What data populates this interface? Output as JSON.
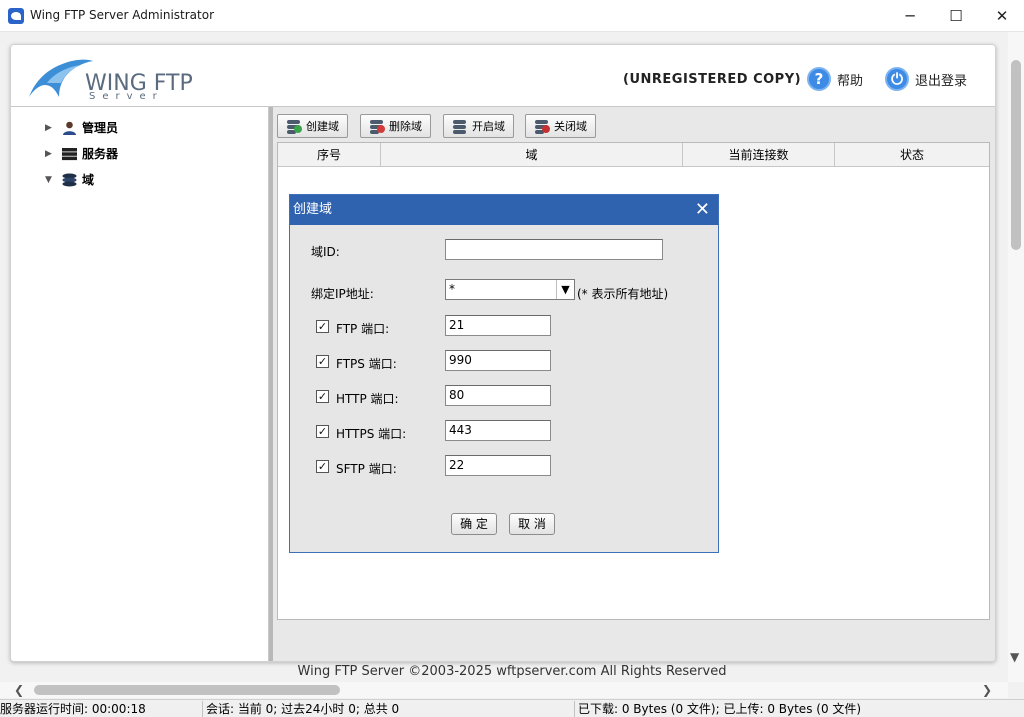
{
  "window": {
    "title": "Wing FTP Server Administrator",
    "minimize": "─",
    "maximize": "☐",
    "close": "✕"
  },
  "header": {
    "logo_text": "WING FTP",
    "logo_sub": "Server",
    "unregistered": "(UNREGISTERED COPY)",
    "help_label": "帮助",
    "help_icon": "?",
    "logout_label": "退出登录",
    "logout_icon": "⏻"
  },
  "tree": {
    "items": [
      {
        "label": "管理员",
        "icon": "user-icon"
      },
      {
        "label": "服务器",
        "icon": "server-icon"
      },
      {
        "label": "域",
        "icon": "domain-stack-icon"
      }
    ]
  },
  "toolbar": {
    "create": "创建域",
    "delete": "删除域",
    "start": "开启域",
    "stop": "关闭域"
  },
  "grid": {
    "columns": [
      "序号",
      "域",
      "当前连接数",
      "状态"
    ]
  },
  "dialog": {
    "title": "创建域",
    "domain_id_label": "域ID:",
    "domain_id_value": "",
    "bind_ip_label": "绑定IP地址:",
    "bind_ip_value": "*",
    "bind_ip_hint": "(* 表示所有地址)",
    "ports": [
      {
        "label": "FTP 端口:",
        "value": "21",
        "checked": true
      },
      {
        "label": "FTPS 端口:",
        "value": "990",
        "checked": true
      },
      {
        "label": "HTTP 端口:",
        "value": "80",
        "checked": true
      },
      {
        "label": "HTTPS 端口:",
        "value": "443",
        "checked": true
      },
      {
        "label": "SFTP 端口:",
        "value": "22",
        "checked": true
      }
    ],
    "ok": "确 定",
    "cancel": "取 消"
  },
  "footer": {
    "copyright": "Wing FTP Server ©2003-2025 wftpserver.com All Rights Reserved"
  },
  "statusbar": {
    "uptime": "服务器运行时间: 00:00:18",
    "sessions": "会话: 当前 0;  过去24小时 0;  总共 0",
    "transfer": "已下载: 0 Bytes (0 文件);  已上传: 0 Bytes (0 文件)"
  },
  "colors": {
    "accent": "#2f63b0",
    "help_blue": "#3e8be5"
  }
}
